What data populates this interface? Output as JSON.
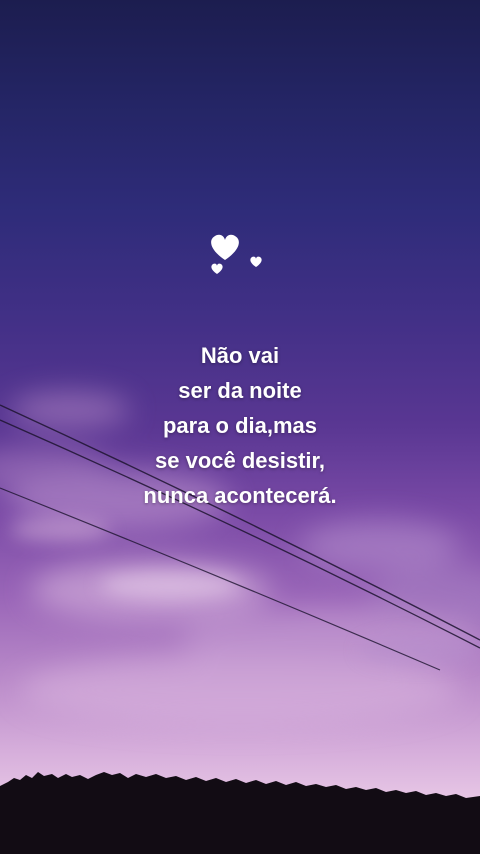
{
  "quote": {
    "lines": [
      "Não vai",
      "ser da noite",
      "para o dia,mas",
      "se você desistir,",
      "nunca acontecerá."
    ]
  },
  "decoration": {
    "icons": [
      "heart-icon-large",
      "heart-icon-small-left",
      "heart-icon-small-right"
    ],
    "heart_color": "#ffffff",
    "text_color": "#ffffff"
  }
}
